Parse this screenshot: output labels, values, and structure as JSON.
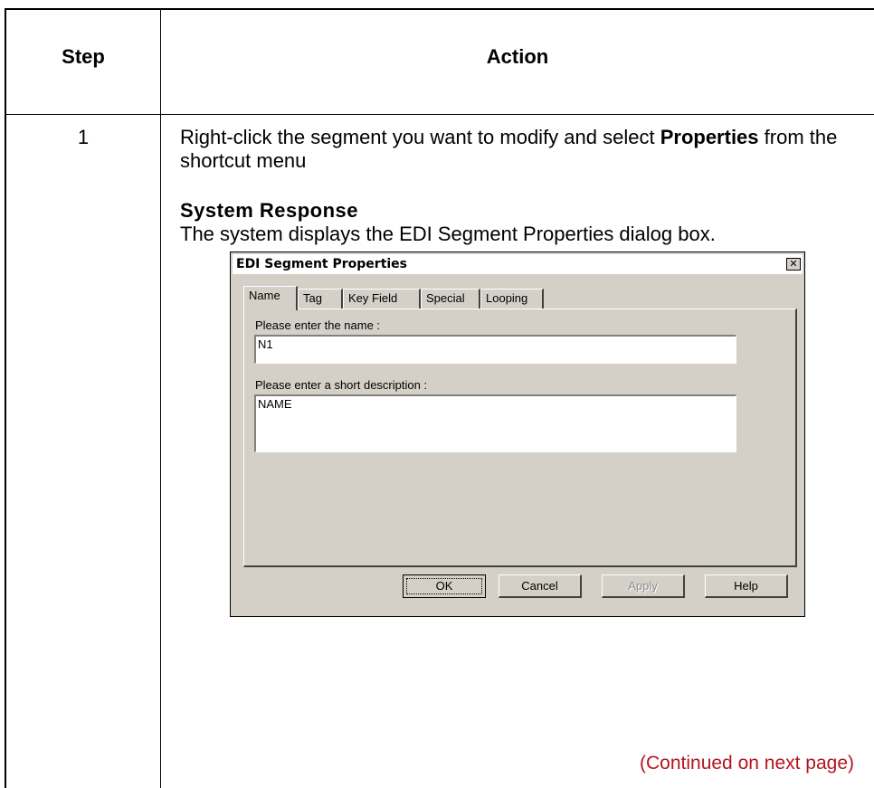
{
  "table": {
    "header_step": "Step",
    "header_action": "Action",
    "step_number": "1",
    "instruction_pre": "Right-click the segment you want to modify and select ",
    "instruction_bold": "Properties",
    "instruction_post": " from the shortcut menu",
    "response_title": "System Response",
    "response_text": "The system displays the EDI Segment Properties dialog box.",
    "continued": "(Continued on next page)"
  },
  "dialog": {
    "title": "EDI Segment Properties",
    "close_glyph": "✕",
    "tabs": [
      "Name",
      "Tag",
      "Key Field",
      "Special",
      "Looping"
    ],
    "active_tab": "Name",
    "name_label": "Please enter the name :",
    "name_value": "N1",
    "desc_label": "Please enter a short description :",
    "desc_value": "NAME",
    "buttons": {
      "ok": "OK",
      "cancel": "Cancel",
      "apply": "Apply",
      "help": "Help"
    }
  },
  "colors": {
    "dialog_face": "#d4d0c8",
    "continued_text": "#b4141e"
  }
}
